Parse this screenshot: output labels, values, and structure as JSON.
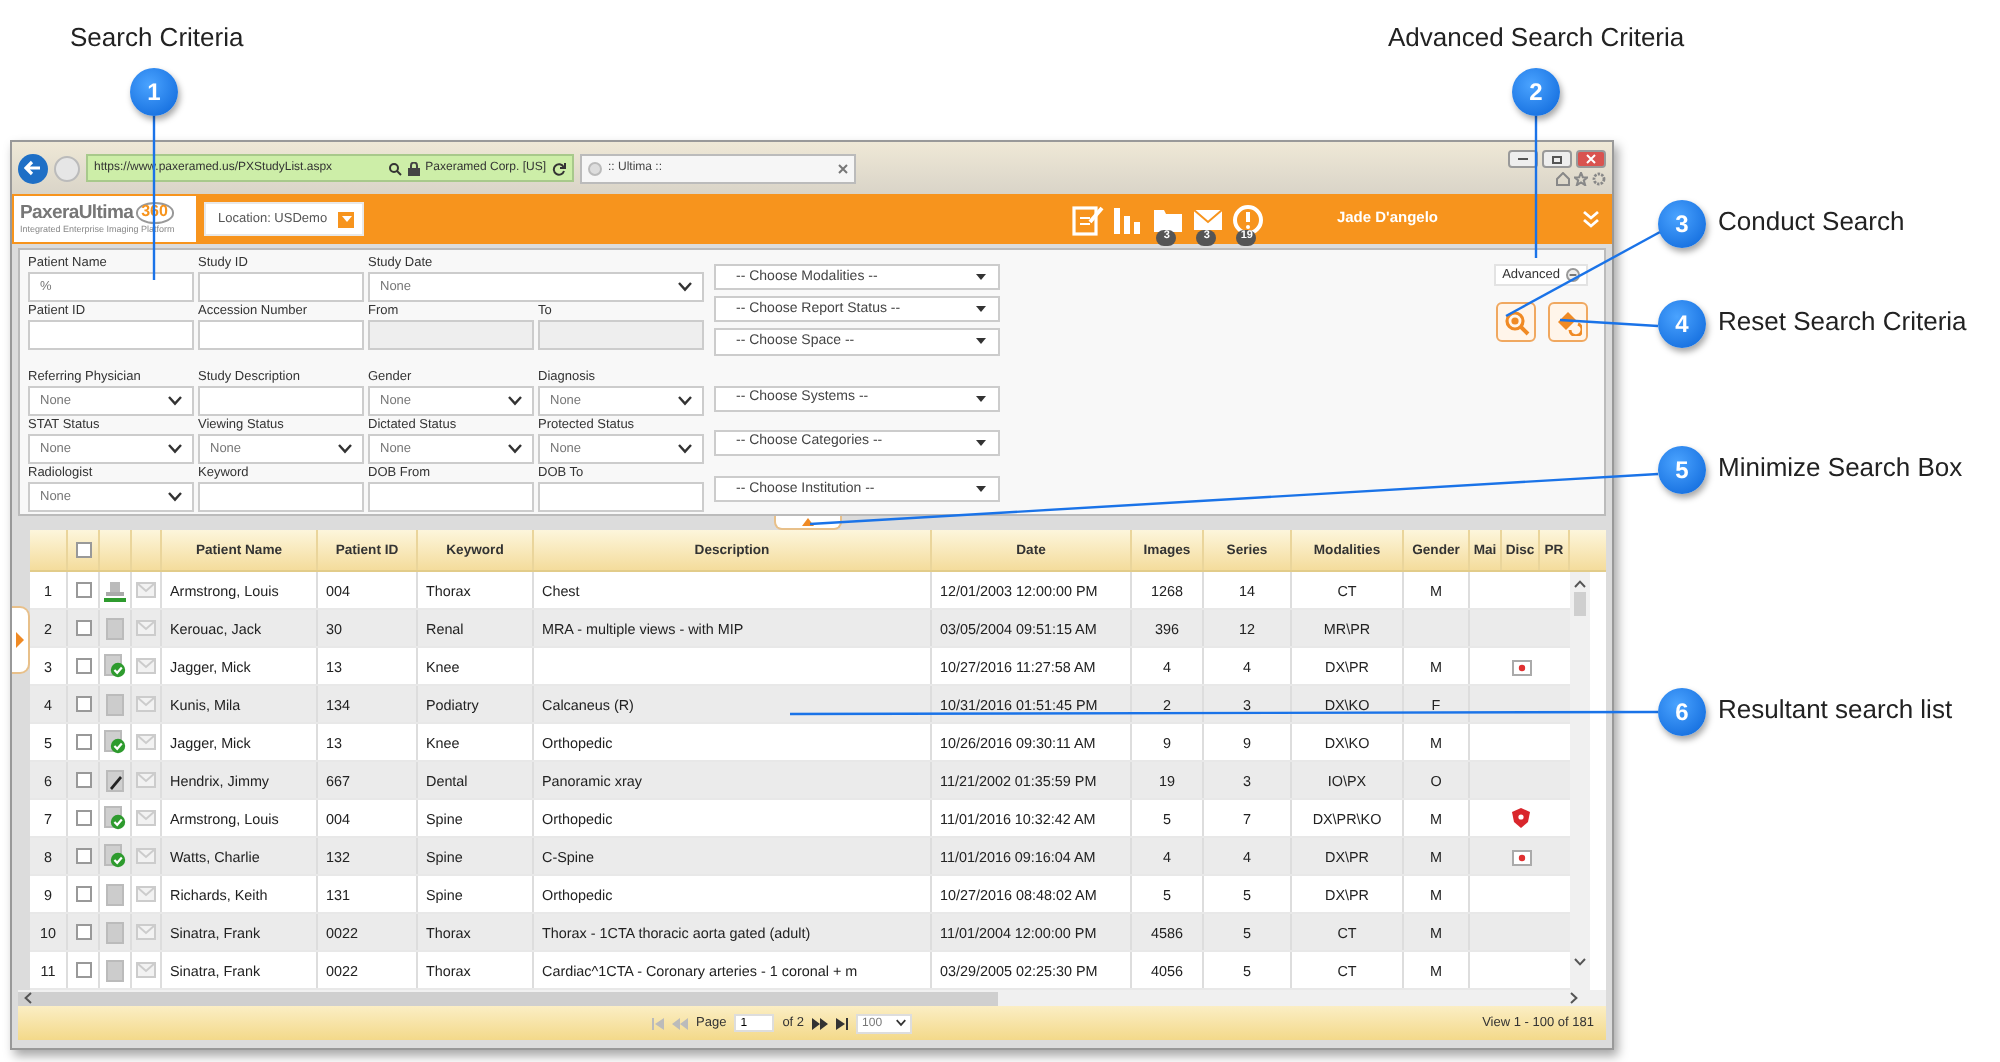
{
  "callouts": [
    {
      "number": "1",
      "label": "Search Criteria"
    },
    {
      "number": "2",
      "label": "Advanced Search Criteria"
    },
    {
      "number": "3",
      "label": "Conduct Search"
    },
    {
      "number": "4",
      "label": "Reset Search Criteria"
    },
    {
      "number": "5",
      "label": "Minimize Search Box"
    },
    {
      "number": "6",
      "label": "Resultant search list"
    }
  ],
  "browser": {
    "url": "https://www.paxeramed.us/PXStudyList.aspx",
    "site_identity": "Paxeramed Corp. [US]",
    "tab_title": ":: Ultima ::"
  },
  "app_header": {
    "logo": "PaxeraUltima",
    "logo_mark": "360",
    "tagline": "Integrated Enterprise Imaging Platform",
    "location": "Location: USDemo",
    "user": "Jade D'angelo",
    "icons": [
      {
        "kind": "notes"
      },
      {
        "kind": "chart"
      },
      {
        "kind": "folder",
        "badge": "3"
      },
      {
        "kind": "mail",
        "badge": "3"
      },
      {
        "kind": "alert",
        "badge": "19"
      }
    ]
  },
  "search_form": {
    "rows": [
      [
        {
          "label": "Patient Name",
          "kind": "text",
          "value": "%"
        },
        {
          "label": "Study ID",
          "kind": "text"
        },
        {
          "label": "Study Date",
          "kind": "select",
          "value": "None",
          "wide": true
        }
      ],
      [
        {
          "label": "Patient ID",
          "kind": "text"
        },
        {
          "label": "Accession Number",
          "kind": "text"
        },
        {
          "label": "From",
          "kind": "readonly"
        },
        {
          "label": "To",
          "kind": "readonly"
        }
      ],
      [
        {
          "label": "Referring Physician",
          "kind": "select",
          "value": "None"
        },
        {
          "label": "Study Description",
          "kind": "text"
        },
        {
          "label": "Gender",
          "kind": "select",
          "value": "None"
        },
        {
          "label": "Diagnosis",
          "kind": "select",
          "value": "None"
        }
      ],
      [
        {
          "label": "STAT Status",
          "kind": "select",
          "value": "None"
        },
        {
          "label": "Viewing Status",
          "kind": "select",
          "value": "None"
        },
        {
          "label": "Dictated Status",
          "kind": "select",
          "value": "None"
        },
        {
          "label": "Protected Status",
          "kind": "select",
          "value": "None"
        }
      ],
      [
        {
          "label": "Radiologist",
          "kind": "select",
          "value": "None"
        },
        {
          "label": "Keyword",
          "kind": "text"
        },
        {
          "label": "DOB From",
          "kind": "text"
        },
        {
          "label": "DOB To",
          "kind": "text"
        }
      ]
    ],
    "dropdowns": [
      "-- Choose Modalities --",
      "-- Choose Report Status --",
      "-- Choose Space --",
      "-- Choose Systems --",
      "-- Choose Categories --",
      "-- Choose Institution --"
    ],
    "advanced": "Advanced"
  },
  "table": {
    "select_all": false,
    "columns": [
      "Patient Name",
      "Patient ID",
      "Keyword",
      "Description",
      "Date",
      "Images",
      "Series",
      "Modalities",
      "Gender",
      "Mai",
      "Disc",
      "PR"
    ],
    "rows": [
      {
        "index": "1",
        "checked": false,
        "report": {
          "kind": "stamp"
        },
        "name": "Armstrong, Louis",
        "id": "004",
        "keyword": "Thorax",
        "description": "Chest",
        "date": "12/01/2003 12:00:00 PM",
        "images": "1268",
        "series": "14",
        "modalities": "CT",
        "gender": "M"
      },
      {
        "index": "2",
        "checked": false,
        "report": {
          "kind": "doc"
        },
        "name": "Kerouac, Jack",
        "id": "30",
        "keyword": "Renal",
        "description": "MRA - multiple views - with MIP",
        "date": "03/05/2004 09:51:15 AM",
        "images": "396",
        "series": "12",
        "modalities": "MR\\PR"
      },
      {
        "index": "3",
        "checked": false,
        "report": {
          "kind": "check"
        },
        "name": "Jagger, Mick",
        "id": "13",
        "keyword": "Knee",
        "date": "10/27/2016 11:27:58 AM",
        "images": "4",
        "series": "4",
        "modalities": "DX\\PR",
        "gender": "M",
        "disc": {
          "kind": "case"
        }
      },
      {
        "index": "4",
        "checked": false,
        "report": {
          "kind": "doc"
        },
        "name": "Kunis, Mila",
        "id": "134",
        "keyword": "Podiatry",
        "description": "Calcaneus (R)",
        "date": "10/31/2016 01:51:45 PM",
        "images": "2",
        "series": "3",
        "modalities": "DX\\KO",
        "gender": "F"
      },
      {
        "index": "5",
        "checked": false,
        "report": {
          "kind": "check"
        },
        "name": "Jagger, Mick",
        "id": "13",
        "keyword": "Knee",
        "description": "Orthopedic",
        "date": "10/26/2016 09:30:11 AM",
        "images": "9",
        "series": "9",
        "modalities": "DX\\KO",
        "gender": "M"
      },
      {
        "index": "6",
        "checked": false,
        "report": {
          "kind": "pen"
        },
        "name": "Hendrix, Jimmy",
        "id": "667",
        "keyword": "Dental",
        "description": "Panoramic xray",
        "date": "11/21/2002 01:35:59 PM",
        "images": "19",
        "series": "3",
        "modalities": "IO\\PX",
        "gender": "O"
      },
      {
        "index": "7",
        "checked": false,
        "report": {
          "kind": "check"
        },
        "name": "Armstrong, Louis",
        "id": "004",
        "keyword": "Spine",
        "description": "Orthopedic",
        "date": "11/01/2016 10:32:42 AM",
        "images": "5",
        "series": "7",
        "modalities": "DX\\PR\\KO",
        "gender": "M",
        "disc": {
          "kind": "shield"
        }
      },
      {
        "index": "8",
        "checked": false,
        "report": {
          "kind": "check"
        },
        "name": "Watts, Charlie",
        "id": "132",
        "keyword": "Spine",
        "description": "C-Spine",
        "date": "11/01/2016 09:16:04 AM",
        "images": "4",
        "series": "4",
        "modalities": "DX\\PR",
        "gender": "M",
        "disc": {
          "kind": "case"
        }
      },
      {
        "index": "9",
        "checked": false,
        "report": {
          "kind": "doc"
        },
        "name": "Richards, Keith",
        "id": "131",
        "keyword": "Spine",
        "description": "Orthopedic",
        "date": "10/27/2016 08:48:02 AM",
        "images": "5",
        "series": "5",
        "modalities": "DX\\PR",
        "gender": "M"
      },
      {
        "index": "10",
        "checked": false,
        "report": {
          "kind": "doc"
        },
        "name": "Sinatra, Frank",
        "id": "0022",
        "keyword": "Thorax",
        "description": "Thorax - 1CTA thoracic aorta gated (adult)",
        "date": "11/01/2004 12:00:00 PM",
        "images": "4586",
        "series": "5",
        "modalities": "CT",
        "gender": "M"
      },
      {
        "index": "11",
        "checked": false,
        "report": {
          "kind": "doc"
        },
        "name": "Sinatra, Frank",
        "id": "0022",
        "keyword": "Thorax",
        "description": "Cardiac^1CTA - Coronary arteries - 1 coronal + m",
        "date": "03/29/2005 02:25:30 PM",
        "images": "4056",
        "series": "5",
        "modalities": "CT",
        "gender": "M"
      }
    ]
  },
  "pager": {
    "page_label": "Page",
    "page": "1",
    "of": "of 2",
    "page_size": "100",
    "summary": "View 1 - 100 of 181"
  }
}
